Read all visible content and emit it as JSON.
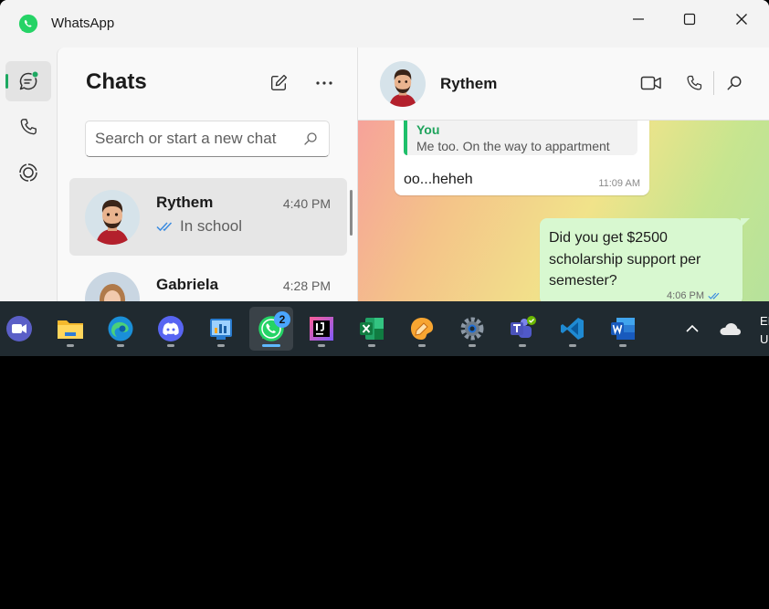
{
  "window": {
    "title": "WhatsApp"
  },
  "sidebar": {
    "items": [
      {
        "name": "chats",
        "icon": "chat-icon"
      },
      {
        "name": "calls",
        "icon": "phone-icon"
      },
      {
        "name": "status",
        "icon": "status-icon"
      }
    ]
  },
  "chatlist": {
    "title": "Chats",
    "search_placeholder": "Search or start a new chat",
    "chats": [
      {
        "name": "Rythem",
        "time": "4:40 PM",
        "preview": "In school"
      },
      {
        "name": "Gabriela",
        "time": "4:28 PM",
        "preview": ""
      }
    ]
  },
  "conversation": {
    "contact_name": "Rythem",
    "messages": {
      "incoming": {
        "quote_author": "You",
        "quote_text": "Me too. On the way to appartment",
        "text": "oo...heheh",
        "time": "11:09 AM"
      },
      "outgoing": {
        "text": "Did you get $2500 scholarship support per semester?",
        "time": "4:06 PM"
      }
    }
  },
  "taskbar": {
    "whatsapp_badge": "2",
    "lang_line1": "EI",
    "lang_line2": "U"
  },
  "colors": {
    "accent": "#1da861",
    "outgoing_bubble": "#d8f8d0",
    "taskbar": "#202a30"
  }
}
